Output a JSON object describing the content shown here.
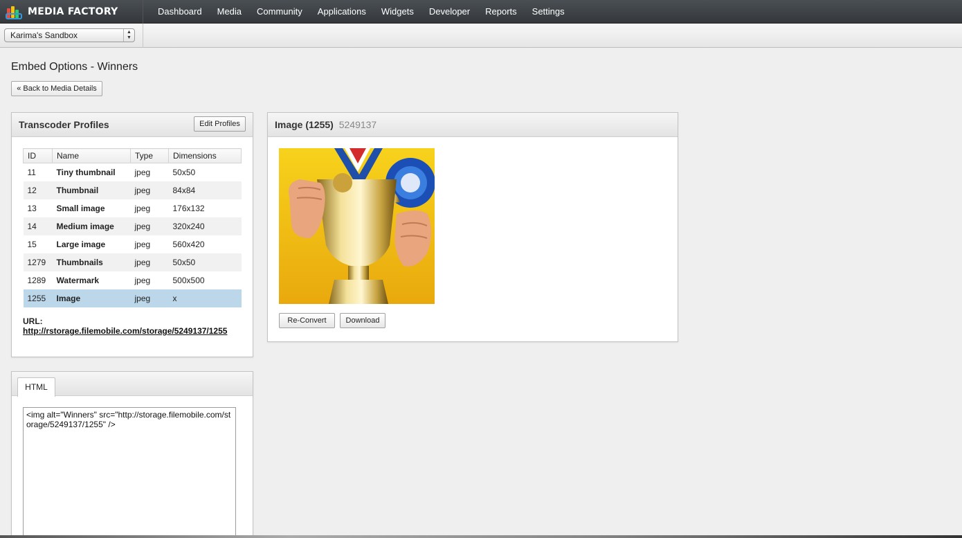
{
  "app": {
    "brand": "MEDIA FACTORY",
    "nav": [
      "Dashboard",
      "Media",
      "Community",
      "Applications",
      "Widgets",
      "Developer",
      "Reports",
      "Settings"
    ],
    "sandbox": "Karima's Sandbox"
  },
  "page": {
    "title": "Embed Options - Winners",
    "back_label": "« Back to Media Details"
  },
  "profiles": {
    "title": "Transcoder Profiles",
    "edit_label": "Edit Profiles",
    "columns": [
      "ID",
      "Name",
      "Type",
      "Dimensions"
    ],
    "rows": [
      {
        "id": "11",
        "name": "Tiny thumbnail",
        "type": "jpeg",
        "dim": "50x50"
      },
      {
        "id": "12",
        "name": "Thumbnail",
        "type": "jpeg",
        "dim": "84x84"
      },
      {
        "id": "13",
        "name": "Small image",
        "type": "jpeg",
        "dim": "176x132"
      },
      {
        "id": "14",
        "name": "Medium image",
        "type": "jpeg",
        "dim": "320x240"
      },
      {
        "id": "15",
        "name": "Large image",
        "type": "jpeg",
        "dim": "560x420"
      },
      {
        "id": "1279",
        "name": "Thumbnails",
        "type": "jpeg",
        "dim": "50x50"
      },
      {
        "id": "1289",
        "name": "Watermark",
        "type": "jpeg",
        "dim": "500x500"
      },
      {
        "id": "1255",
        "name": "Image",
        "type": "jpeg",
        "dim": "x"
      }
    ],
    "selected_id": "1255",
    "url_label": "URL:",
    "url": "http://rstorage.filemobile.com/storage/5249137/1255"
  },
  "embed": {
    "tab_label": "HTML",
    "code": "<img alt=\"Winners\" src=\"http://storage.filemobile.com/storage/5249137/1255\" />"
  },
  "image_panel": {
    "title": "Image (1255)",
    "media_id": "5249137",
    "reconvert_label": "Re-Convert",
    "download_label": "Download"
  },
  "colors": {
    "topbar": "#3d4246",
    "selected_row": "#bcd7ea",
    "trophy_bg": "#f5c518"
  }
}
